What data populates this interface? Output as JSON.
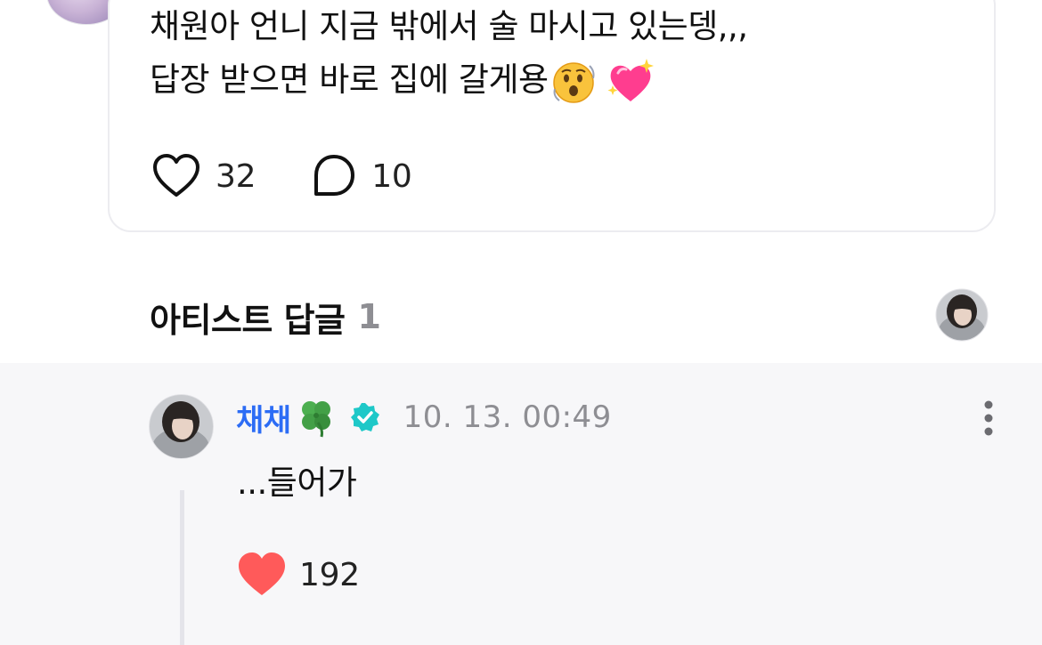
{
  "post": {
    "lines": [
      "채원아 언니 지금 밖에서 술 마시고 있는뎅,,,",
      "답장 받으면 바로 집에 갈게용"
    ],
    "emojis": [
      "face-with-open-mouth-dizzy-emoji",
      "sparkling-heart-emoji"
    ],
    "likes": "32",
    "comments": "10"
  },
  "artist_reply": {
    "title": "아티스트 답글",
    "count": "1",
    "author": "채채",
    "author_emoji": "four-leaf-clover-emoji",
    "verified": true,
    "timestamp": "10. 13. 00:49",
    "text": "...들어가",
    "likes": "192"
  },
  "colors": {
    "author_name": "#2c6cf5",
    "verified_badge": "#1ec8c8",
    "liked_heart": "#ff5a5a",
    "reply_bg": "#f7f7f9",
    "muted": "#8e8e93"
  }
}
